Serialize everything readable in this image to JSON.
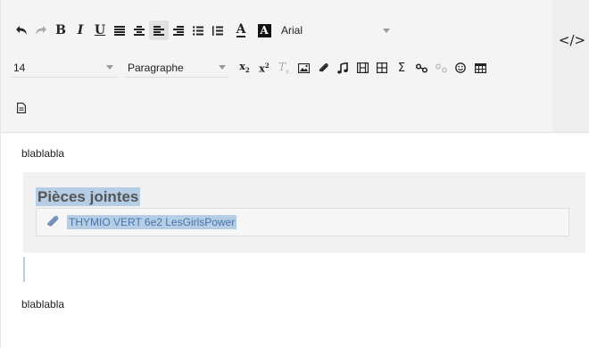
{
  "toolbar": {
    "font_family": {
      "value": "Arial"
    },
    "font_size": {
      "value": "14"
    },
    "block_format": {
      "value": "Paragraphe"
    },
    "code_view_label": "</>",
    "colors": {
      "accent_highlight": "#b6cde6",
      "link": "#4a74a8",
      "toolbar_bg": "#f4f4f4"
    }
  },
  "content": {
    "paragraph_1": "blablabla",
    "attachments": {
      "title": "Pièces jointes",
      "items": [
        {
          "name": "THYMIO VERT 6e2 LesGirlsPower"
        }
      ]
    },
    "paragraph_2": "blablabla"
  }
}
